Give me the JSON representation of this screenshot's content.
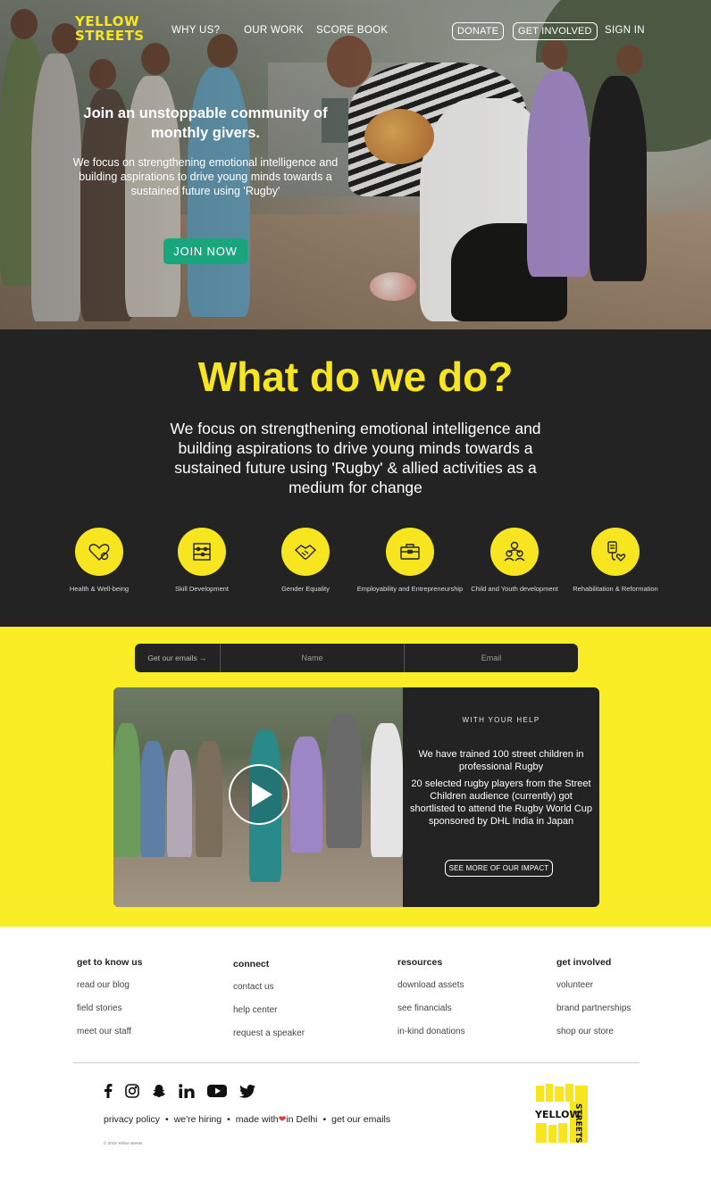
{
  "nav": {
    "logo_line1": "YELLOW",
    "logo_line2": "STREETS",
    "links": [
      "WHY US?",
      "OUR WORK",
      "SCORE BOOK"
    ],
    "donate_label": "DONATE",
    "get_involved_label": "GET INVOLVED",
    "sign_in_label": "SIGN IN"
  },
  "hero": {
    "title": "Join an unstoppable community of monthly givers.",
    "subtitle": "We focus on strengthening emotional intelligence and building aspirations to drive young minds towards a sustained future using 'Rugby'",
    "cta_label": "JOIN NOW"
  },
  "what": {
    "title": "What do we do?",
    "subtitle": "We focus on strengthening emotional intelligence and building aspirations to drive young minds towards a sustained future using 'Rugby' & allied activities as a medium for change",
    "features": [
      {
        "label": "Health & Well-being",
        "icon": "heart-icon"
      },
      {
        "label": "Skill Development",
        "icon": "abacus-icon"
      },
      {
        "label": "Gender Equality",
        "icon": "handshake-icon"
      },
      {
        "label": "Employability and Entrepreneurship",
        "icon": "briefcase-icon"
      },
      {
        "label": "Child and Youth development",
        "icon": "people-icon"
      },
      {
        "label": "Rehabilitation & Reformation",
        "icon": "drip-icon"
      }
    ]
  },
  "signup": {
    "label": "Get our emails →",
    "name_placeholder": "Name",
    "email_placeholder": "Email"
  },
  "impact": {
    "eyebrow": "WITH YOUR HELP",
    "para1": "We have trained 100 street children in professional Rugby",
    "para2": "20 selected rugby players from the Street Children audience (currently) got shortlisted to attend the Rugby World Cup sponsored by DHL India in Japan",
    "button_label": "SEE MORE OF OUR IMPACT"
  },
  "footer": {
    "columns": [
      {
        "heading": "get to know us",
        "links": [
          "read our blog",
          "field stories",
          "meet our staff"
        ]
      },
      {
        "heading": "connect",
        "links": [
          "contact us",
          "help center",
          "request a speaker"
        ]
      },
      {
        "heading": "resources",
        "links": [
          "download assets",
          "see financials",
          "in-kind donations"
        ]
      },
      {
        "heading": "get involved",
        "links": [
          "volunteer",
          "brand partnerships",
          "shop our store"
        ]
      }
    ],
    "social_icons": [
      "facebook-icon",
      "instagram-icon",
      "snapchat-icon",
      "linkedin-icon",
      "youtube-icon",
      "twitter-icon"
    ],
    "privacy": "privacy policy",
    "hiring": "we're hiring",
    "made_with_prefix": "made with",
    "made_with_suffix": "in Delhi",
    "emails": "get our emails",
    "copyright": "© 2019 Yellow streets",
    "logo_word1": "YELLOW",
    "logo_word2": "STREETS"
  },
  "colors": {
    "brand_yellow": "#f7e61f",
    "band_yellow": "#faed26",
    "dark": "#232323",
    "cta_green": "#19a67c",
    "heart_red": "#e03a3a"
  }
}
